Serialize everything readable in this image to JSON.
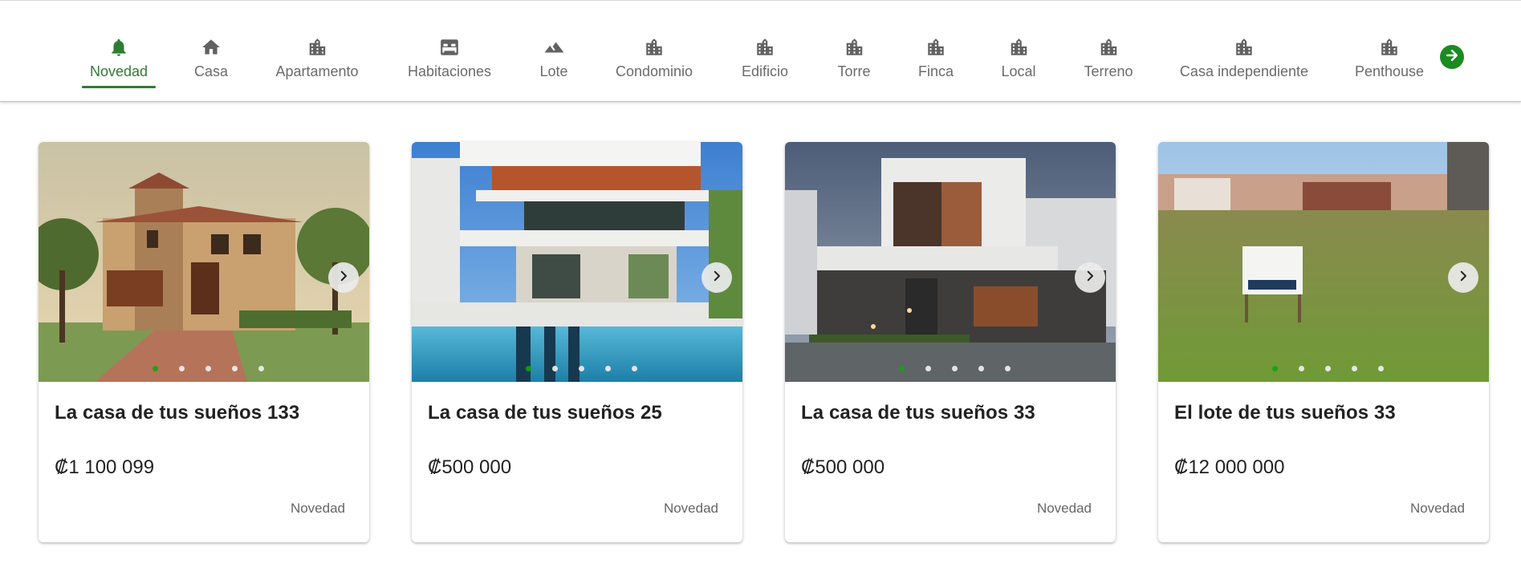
{
  "categories": [
    {
      "label": "Novedad",
      "icon": "bell-icon",
      "active": true
    },
    {
      "label": "Casa",
      "icon": "home-icon",
      "active": false
    },
    {
      "label": "Apartamento",
      "icon": "building-icon",
      "active": false
    },
    {
      "label": "Habitaciones",
      "icon": "bed-icon",
      "active": false
    },
    {
      "label": "Lote",
      "icon": "landscape-icon",
      "active": false
    },
    {
      "label": "Condominio",
      "icon": "building-icon",
      "active": false
    },
    {
      "label": "Edificio",
      "icon": "building-icon",
      "active": false
    },
    {
      "label": "Torre",
      "icon": "building-icon",
      "active": false
    },
    {
      "label": "Finca",
      "icon": "building-icon",
      "active": false
    },
    {
      "label": "Local",
      "icon": "building-icon",
      "active": false
    },
    {
      "label": "Terreno",
      "icon": "building-icon",
      "active": false
    },
    {
      "label": "Casa independiente",
      "icon": "building-icon",
      "active": false
    },
    {
      "label": "Penthouse",
      "icon": "building-icon",
      "active": false
    }
  ],
  "colors": {
    "accent": "#2e7d32",
    "dot_active": "#16a016",
    "next_button": "#1b8a22",
    "icon_gray": "#616161"
  },
  "listings": [
    {
      "title": "La casa de tus sueños 133",
      "price": "₡1 100 099",
      "tag": "Novedad",
      "photo": "mediterranean-stone-house",
      "slides": 5,
      "active_slide": 1
    },
    {
      "title": "La casa de tus sueños 25",
      "price": "₡500 000",
      "tag": "Novedad",
      "photo": "modern-house-with-pool",
      "slides": 5,
      "active_slide": 1
    },
    {
      "title": "La casa de tus sueños 33",
      "price": "₡500 000",
      "tag": "Novedad",
      "photo": "modern-house-at-dusk",
      "slides": 5,
      "active_slide": 1
    },
    {
      "title": "El lote de tus sueños 33",
      "price": "₡12 000 000",
      "tag": "Novedad",
      "photo": "grass-lot-for-sale",
      "slides": 5,
      "active_slide": 1
    }
  ]
}
